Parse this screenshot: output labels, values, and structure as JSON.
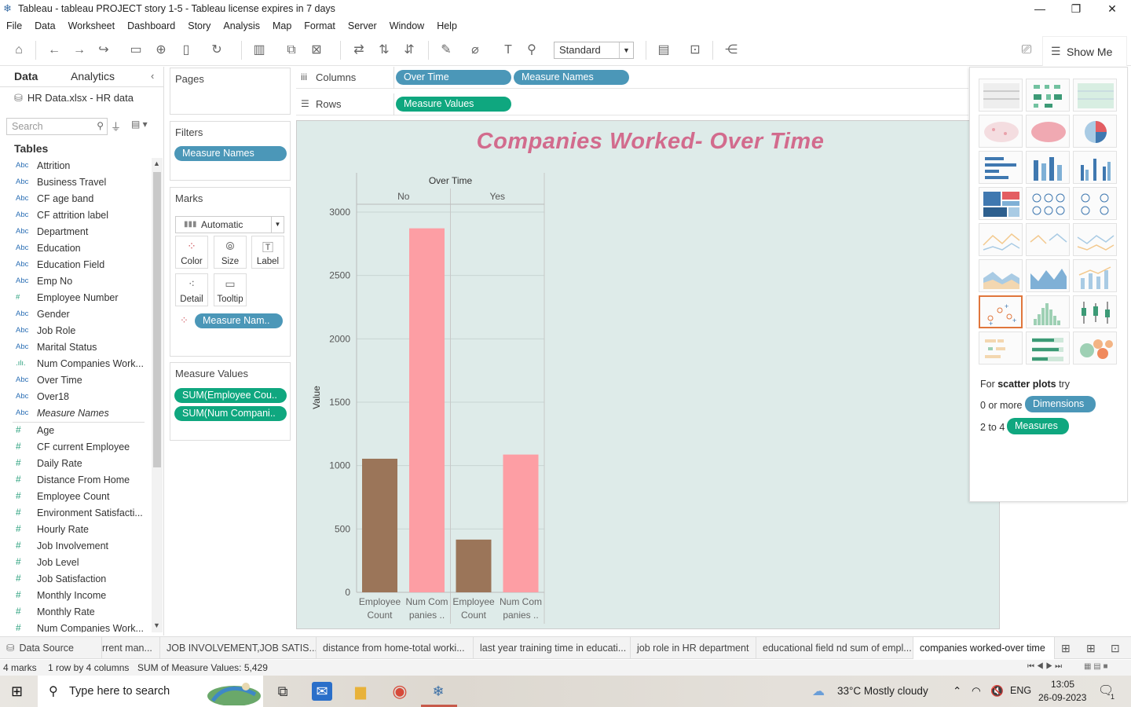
{
  "window": {
    "title": "Tableau - tableau PROJECT story 1-5 - Tableau license expires in 7 days",
    "minimize": "—",
    "restore": "❐",
    "close": "✕"
  },
  "menu": [
    "File",
    "Data",
    "Worksheet",
    "Dashboard",
    "Story",
    "Analysis",
    "Map",
    "Format",
    "Server",
    "Window",
    "Help"
  ],
  "toolbar": {
    "fit_select": "Standard",
    "show_me": "Show Me"
  },
  "data_pane": {
    "tab_data": "Data",
    "tab_analytics": "Analytics",
    "source": "HR Data.xlsx - HR data",
    "search_placeholder": "Search",
    "tables_label": "Tables",
    "dimensions": [
      {
        "type": "Abc",
        "name": "Attrition"
      },
      {
        "type": "Abc",
        "name": "Business Travel"
      },
      {
        "type": "Abc",
        "name": "CF age band"
      },
      {
        "type": "Abc",
        "name": "CF attrition label"
      },
      {
        "type": "Abc",
        "name": "Department"
      },
      {
        "type": "Abc",
        "name": "Education"
      },
      {
        "type": "Abc",
        "name": "Education Field"
      },
      {
        "type": "Abc",
        "name": "Emp No"
      },
      {
        "type": "#",
        "name": "Employee Number"
      },
      {
        "type": "Abc",
        "name": "Gender"
      },
      {
        "type": "Abc",
        "name": "Job Role"
      },
      {
        "type": "Abc",
        "name": "Marital Status"
      },
      {
        "type": ".ılı.",
        "name": "Num Companies Work..."
      },
      {
        "type": "Abc",
        "name": "Over Time"
      },
      {
        "type": "Abc",
        "name": "Over18"
      },
      {
        "type": "Abc",
        "name": "Measure Names"
      }
    ],
    "measures": [
      {
        "type": "#",
        "name": "Age"
      },
      {
        "type": "#",
        "name": "CF current Employee"
      },
      {
        "type": "#",
        "name": "Daily Rate"
      },
      {
        "type": "#",
        "name": "Distance From Home"
      },
      {
        "type": "#",
        "name": "Employee Count"
      },
      {
        "type": "#",
        "name": "Environment Satisfacti..."
      },
      {
        "type": "#",
        "name": "Hourly Rate"
      },
      {
        "type": "#",
        "name": "Job Involvement"
      },
      {
        "type": "#",
        "name": "Job Level"
      },
      {
        "type": "#",
        "name": "Job Satisfaction"
      },
      {
        "type": "#",
        "name": "Monthly Income"
      },
      {
        "type": "#",
        "name": "Monthly Rate"
      },
      {
        "type": "#",
        "name": "Num Companies Work..."
      }
    ]
  },
  "pages_card": {
    "title": "Pages"
  },
  "filters_card": {
    "title": "Filters",
    "pill": "Measure Names"
  },
  "marks_card": {
    "title": "Marks",
    "type": "Automatic",
    "buttons": [
      "Color",
      "Size",
      "Label",
      "Detail",
      "Tooltip"
    ],
    "color_pill": "Measure Nam.."
  },
  "measure_values_card": {
    "title": "Measure Values",
    "pills": [
      "SUM(Employee Cou..",
      "SUM(Num Compani.."
    ]
  },
  "shelves": {
    "columns_label": "Columns",
    "columns_pills": [
      "Over Time",
      "Measure Names"
    ],
    "rows_label": "Rows",
    "rows_pills": [
      "Measure Values"
    ]
  },
  "viz": {
    "title": "Companies Worked- Over Time"
  },
  "chart_data": {
    "type": "bar",
    "title": "Companies Worked- Over Time",
    "column_header": "Over Time",
    "groups": [
      "No",
      "Yes"
    ],
    "categories_lines": [
      [
        "Employee",
        "Count"
      ],
      [
        "Num Com",
        "panies .."
      ]
    ],
    "ylabel": "Value",
    "ylim": [
      0,
      3000
    ],
    "yticks": [
      0,
      500,
      1000,
      1500,
      2000,
      2500,
      3000
    ],
    "grid": true,
    "series": [
      {
        "name": "Employee Count",
        "color": "#9b7559",
        "values": [
          1054,
          416
        ]
      },
      {
        "name": "Num Companies Worked",
        "color": "#fd9ea4",
        "values": [
          2872,
          1087
        ]
      }
    ]
  },
  "show_me": {
    "hint_prefix": "For",
    "hint_bold": "scatter plots",
    "hint_suffix": "try",
    "dims_text": "0 or more",
    "dims_pill": "Dimensions",
    "meas_text": "2 to 4",
    "meas_pill": "Measures"
  },
  "sheet_tabs": {
    "data_source": "Data Source",
    "tabs": [
      "rrent man...",
      "JOB INVOLVEMENT,JOB SATIS...",
      "distance from home-total worki...",
      "last year training time in educati...",
      "job role in HR department",
      "educational field nd sum of empl...",
      "companies worked-over time"
    ]
  },
  "status": {
    "marks": "4 marks",
    "rows_cols": "1 row by 4 columns",
    "sum": "SUM of Measure Values: 5,429"
  },
  "taskbar": {
    "search": "Type here to search",
    "weather": "33°C  Mostly cloudy",
    "lang": "ENG",
    "time": "13:05",
    "date": "26-09-2023",
    "notif": "1"
  },
  "colors": {
    "pill_blue": "#4b97b8",
    "pill_green": "#0fa77f",
    "title_pink": "#d26b8d",
    "viz_bg": "#deebe9"
  }
}
